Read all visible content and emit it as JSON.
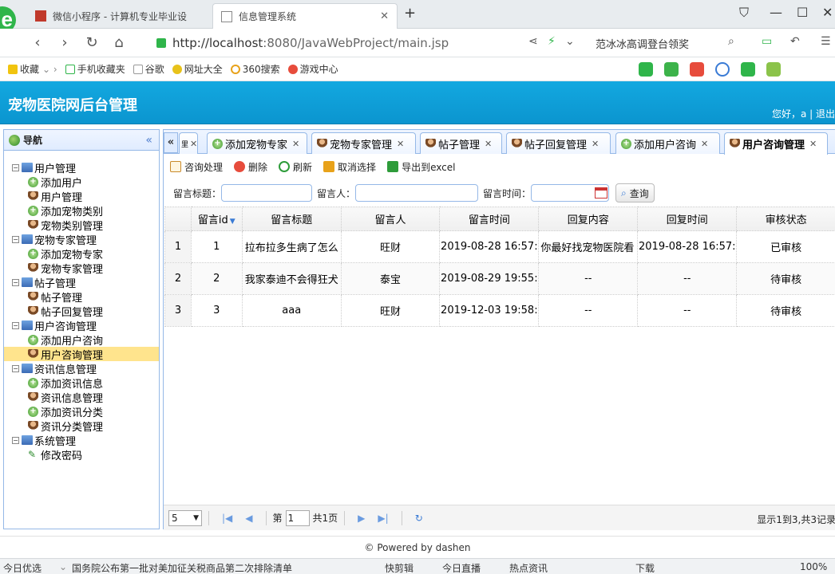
{
  "browser": {
    "tabs": [
      {
        "title": "微信小程序 - 计算机专业毕业设"
      },
      {
        "title": "信息管理系统"
      }
    ],
    "url_host": "http://localhost",
    "url_path": ":8080/JavaWebProject/main.jsp",
    "search_query": "范冰冰高调登台领奖",
    "bookmarks": [
      "收藏",
      "手机收藏夹",
      "谷歌",
      "网址大全",
      "360搜索",
      "游戏中心"
    ]
  },
  "app": {
    "title": "宠物医院网后台管理",
    "greeting": "您好，a | 退出",
    "footer": "© Powered by dashen"
  },
  "nav": {
    "title": "导航",
    "collapse": "«",
    "groups": [
      {
        "label": "用户管理",
        "items": [
          "添加用户",
          "用户管理",
          "添加宠物类别",
          "宠物类别管理"
        ]
      },
      {
        "label": "宠物专家管理",
        "items": [
          "添加宠物专家",
          "宠物专家管理"
        ]
      },
      {
        "label": "帖子管理",
        "items": [
          "帖子管理",
          "帖子回复管理"
        ]
      },
      {
        "label": "用户咨询管理",
        "items": [
          "添加用户咨询",
          "用户咨询管理"
        ]
      },
      {
        "label": "资讯信息管理",
        "items": [
          "添加资讯信息",
          "资讯信息管理",
          "添加资讯分类",
          "资讯分类管理"
        ]
      },
      {
        "label": "系统管理",
        "items": [
          "修改密码"
        ]
      }
    ]
  },
  "main": {
    "tabs": [
      "里",
      "添加宠物专家",
      "宠物专家管理",
      "帖子管理",
      "帖子回复管理",
      "添加用户咨询",
      "用户咨询管理"
    ],
    "toolbar": [
      "咨询处理",
      "删除",
      "刷新",
      "取消选择",
      "导出到excel"
    ],
    "search": {
      "title_label": "留言标题：",
      "person_label": "留言人：",
      "time_label": "留言时间：",
      "query_button": "查询"
    },
    "columns": [
      "留言id",
      "留言标题",
      "留言人",
      "留言时间",
      "回复内容",
      "回复时间",
      "审核状态"
    ],
    "rows": [
      {
        "rownum": "1",
        "id": "1",
        "title": "拉布拉多生病了怎么",
        "person": "旺财",
        "time": "2019-08-28 16:57:",
        "reply": "你最好找宠物医院看",
        "reply_time": "2019-08-28 16:57:",
        "status": "已审核"
      },
      {
        "rownum": "2",
        "id": "2",
        "title": "我家泰迪不会得狂犬",
        "person": "泰宝",
        "time": "2019-08-29 19:55:",
        "reply": "--",
        "reply_time": "--",
        "status": "待审核"
      },
      {
        "rownum": "3",
        "id": "3",
        "title": "aaa",
        "person": "旺财",
        "time": "2019-12-03 19:58:",
        "reply": "--",
        "reply_time": "--",
        "status": "待审核"
      }
    ],
    "pager": {
      "page_size": "5",
      "page_prefix": "第",
      "page_value": "1",
      "page_total": "共1页",
      "info": "显示1到3,共3记录"
    }
  },
  "statusbar": {
    "left": "今日优选",
    "news": "国务院公布第一批对美加征关税商品第二次排除清单",
    "items": [
      "快剪辑",
      "今日直播",
      "热点资讯",
      "下载",
      "100%"
    ]
  }
}
